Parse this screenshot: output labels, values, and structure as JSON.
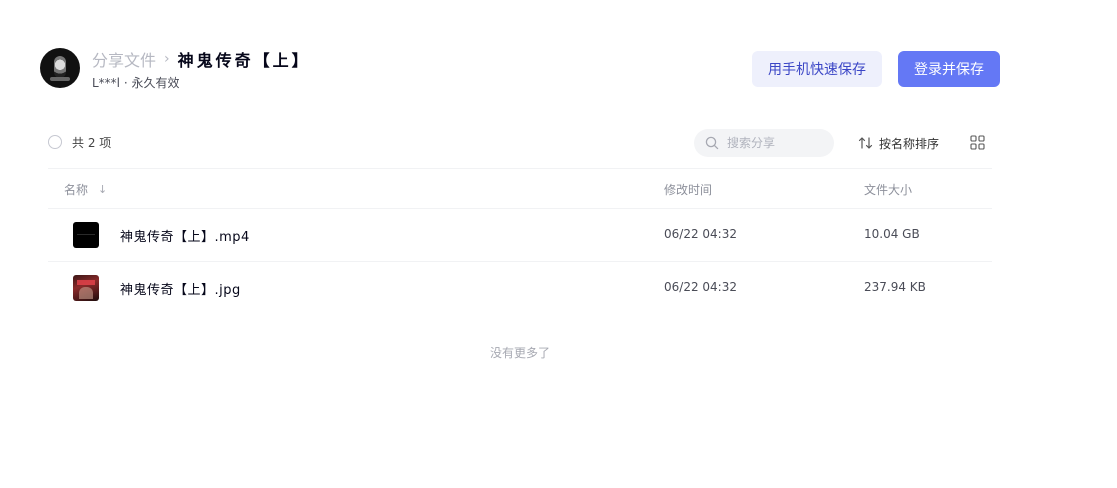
{
  "header": {
    "breadcrumb_root": "分享文件",
    "breadcrumb_sep": "›",
    "title": "神鬼传奇【上】",
    "owner_meta": "L***l · 永久有效"
  },
  "actions": {
    "mobile_save_label": "用手机快速保存",
    "login_save_label": "登录并保存"
  },
  "toolbar": {
    "count_label": "共 2 项",
    "search_placeholder": "搜索分享",
    "sort_label": "按名称排序"
  },
  "table": {
    "columns": {
      "name": "名称",
      "name_sort_icon": "↓",
      "modified": "修改时间",
      "size": "文件大小"
    },
    "rows": [
      {
        "name": "神鬼传奇【上】.mp4",
        "modified": "06/22 04:32",
        "size": "10.04 GB",
        "icon": "video-thumbnail"
      },
      {
        "name": "神鬼传奇【上】.jpg",
        "modified": "06/22 04:32",
        "size": "237.94 KB",
        "icon": "image-thumbnail"
      }
    ]
  },
  "footer": {
    "no_more": "没有更多了"
  },
  "colors": {
    "primary": "#6478f5",
    "secondary_bg": "#eef0fc",
    "secondary_text": "#3b46c6"
  }
}
